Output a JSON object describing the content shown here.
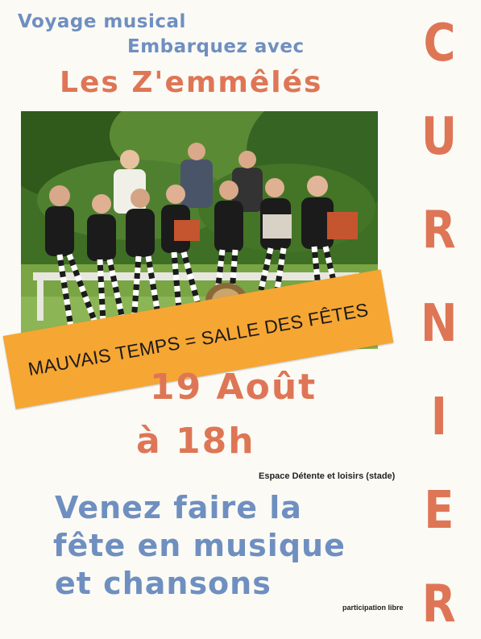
{
  "poster": {
    "intro_line1": "Voyage musical",
    "intro_line2": "Embarquez avec",
    "band_name": "Les Z'emmêlés",
    "village_name": "CURNIER",
    "banner_text": "MAUVAIS TEMPS = SALLE DES FÊTES",
    "date": "19 Août",
    "time": "à 18h",
    "venue": "Espace Détente et loisirs (stade)",
    "invitation": [
      "Venez faire la",
      "fête en musique",
      "et chansons"
    ],
    "price_note": "participation libre"
  },
  "colors": {
    "title_blue": "#6f8fc0",
    "title_orange": "#de7656",
    "banner_orange": "#f6a633",
    "background": "#fbfaf5"
  }
}
